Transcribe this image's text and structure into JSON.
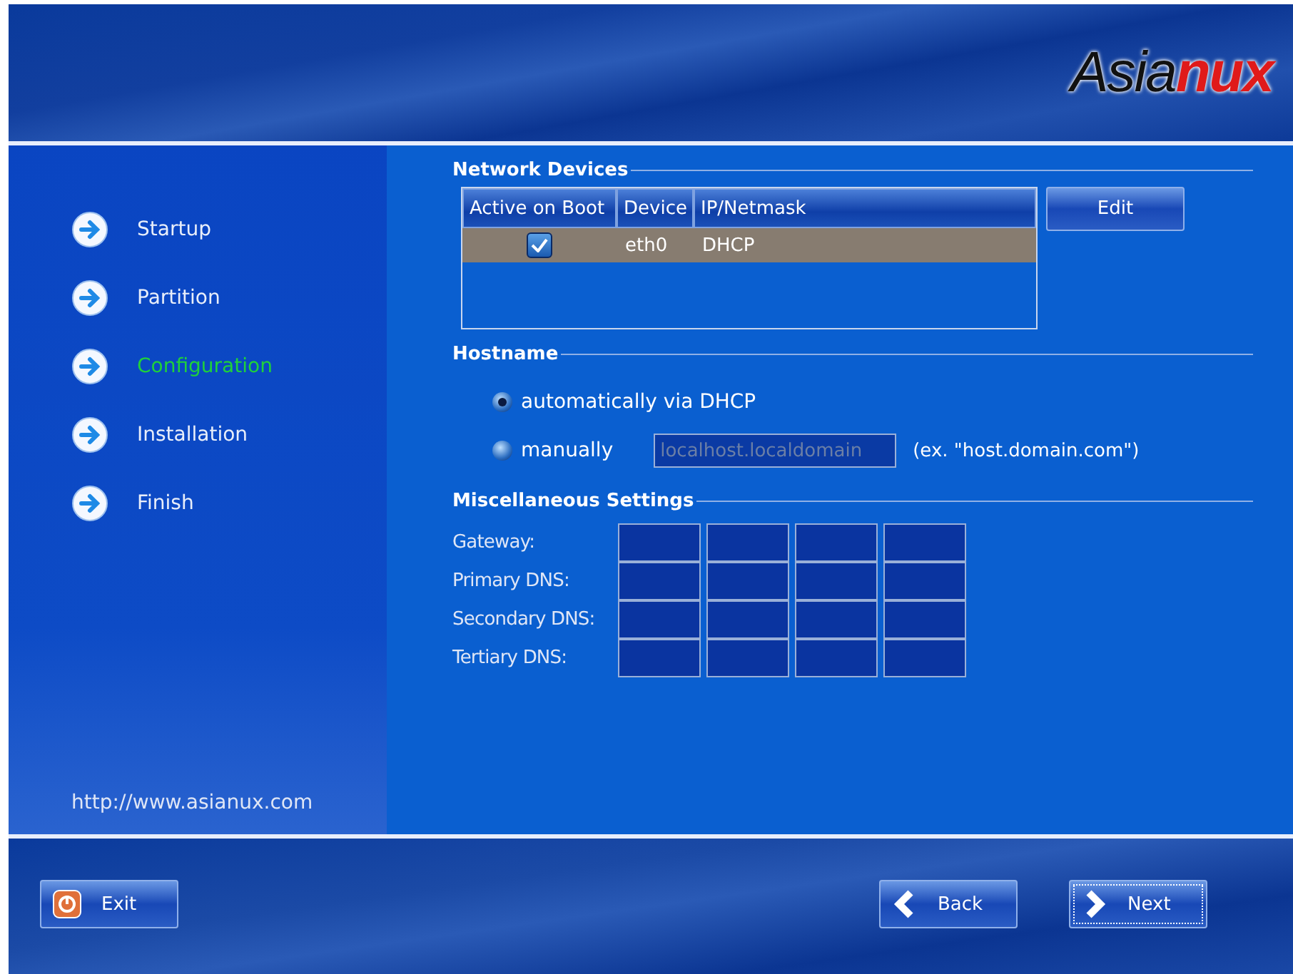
{
  "logo": {
    "first": "Asia",
    "second": "nux"
  },
  "steps": [
    {
      "label": "Startup",
      "selected": false
    },
    {
      "label": "Partition",
      "selected": false
    },
    {
      "label": "Configuration",
      "selected": true
    },
    {
      "label": "Installation",
      "selected": false
    },
    {
      "label": "Finish",
      "selected": false
    }
  ],
  "website": "http://www.asianux.com",
  "network_devices": {
    "title": "Network Devices",
    "columns": [
      "Active on Boot",
      "Device",
      "IP/Netmask"
    ],
    "rows": [
      {
        "checked": true,
        "device": "eth0",
        "ip": "DHCP",
        "selected": true
      }
    ],
    "edit_button": "Edit"
  },
  "hostname": {
    "title": "Hostname",
    "options": [
      {
        "label": "automatically via DHCP",
        "selected": true
      },
      {
        "label": "manually",
        "selected": false
      }
    ],
    "field": {
      "value": "localhost.localdomain",
      "disabled": true
    },
    "hint": "(ex. \"host.domain.com\")"
  },
  "misc": {
    "title": "Miscellaneous Settings",
    "fields": [
      "Gateway:",
      "Primary DNS:",
      "Secondary DNS:",
      "Tertiary DNS:"
    ]
  },
  "buttons": {
    "exit": "Exit",
    "back": "Back",
    "next": "Next"
  }
}
